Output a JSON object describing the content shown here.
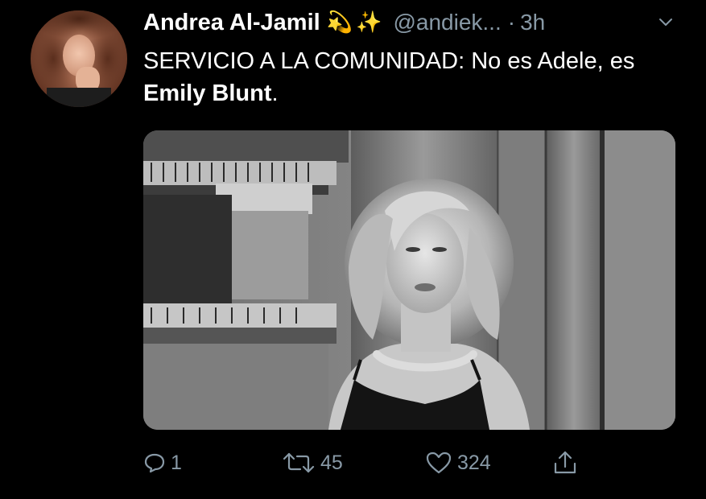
{
  "tweet": {
    "display_name": "Andrea Al-Jamil",
    "name_emojis": [
      "💫",
      "✨"
    ],
    "handle": "@andiek...",
    "separator": "·",
    "time": "3h",
    "text_prefix": "SERVICIO A LA COMUNIDAD: No es Adele, es ",
    "text_bold": "Emily Blunt",
    "text_suffix": "."
  },
  "actions": {
    "reply_count": "1",
    "retweet_count": "45",
    "like_count": "324"
  },
  "icons": {
    "more": "chevron-down-icon",
    "reply": "reply-icon",
    "retweet": "retweet-icon",
    "like": "heart-icon",
    "share": "share-icon"
  },
  "colors": {
    "background": "#000000",
    "text": "#ffffff",
    "secondary": "#8899a6"
  }
}
